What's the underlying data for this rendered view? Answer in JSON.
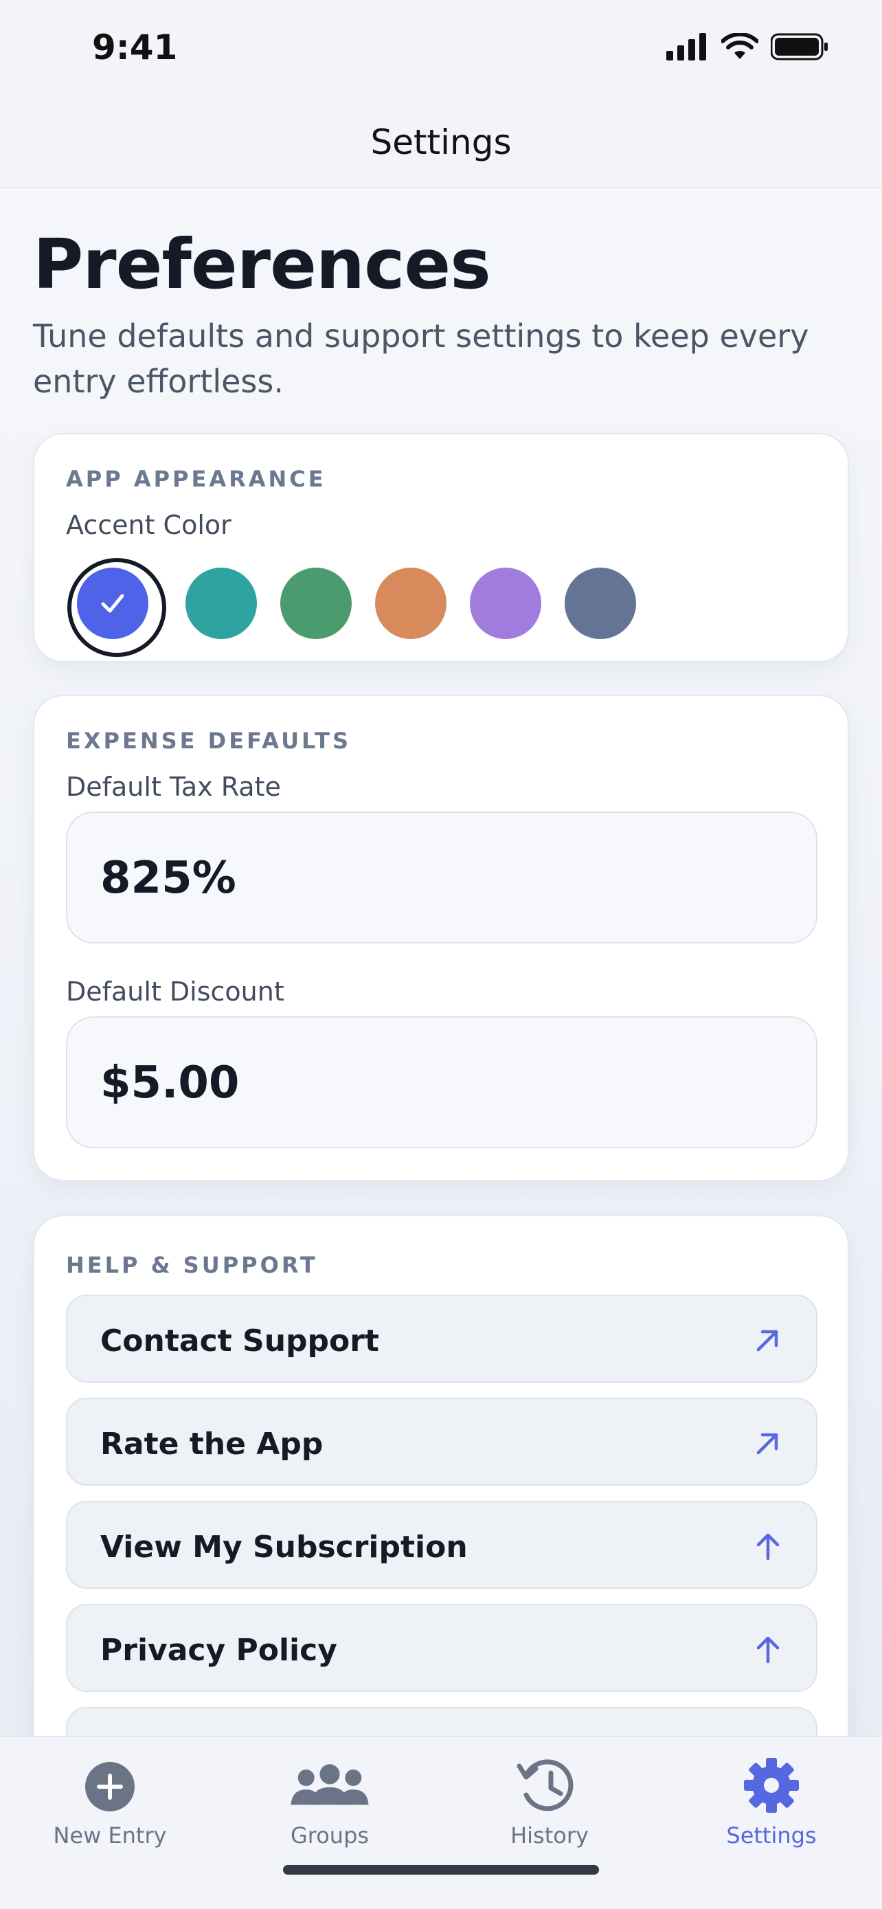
{
  "status_bar": {
    "time": "9:41"
  },
  "nav": {
    "title": "Settings"
  },
  "header": {
    "title": "Preferences",
    "subtitle": "Tune defaults and support settings to keep every entry effortless."
  },
  "appearance": {
    "section_title": "APP APPEARANCE",
    "accent_label": "Accent Color",
    "swatches": [
      {
        "name": "blue",
        "color": "#4f63e8",
        "selected": true
      },
      {
        "name": "teal",
        "color": "#2fa3a0",
        "selected": false
      },
      {
        "name": "green",
        "color": "#4a9c6e",
        "selected": false
      },
      {
        "name": "orange",
        "color": "#d88a5c",
        "selected": false
      },
      {
        "name": "purple",
        "color": "#a07cdc",
        "selected": false
      },
      {
        "name": "slate",
        "color": "#647494",
        "selected": false
      }
    ]
  },
  "expense": {
    "section_title": "EXPENSE DEFAULTS",
    "tax_label": "Default Tax Rate",
    "tax_value": "825%",
    "discount_label": "Default Discount",
    "discount_value": "$5.00"
  },
  "support": {
    "section_title": "HELP & SUPPORT",
    "items": [
      {
        "label": "Contact Support",
        "icon": "arrow-up-right-icon"
      },
      {
        "label": "Rate the App",
        "icon": "arrow-up-right-icon"
      },
      {
        "label": "View My Subscription",
        "icon": "arrow-up-icon"
      },
      {
        "label": "Privacy Policy",
        "icon": "arrow-up-icon"
      }
    ]
  },
  "tabs": [
    {
      "label": "New Entry",
      "icon": "plus-circle-icon",
      "active": false
    },
    {
      "label": "Groups",
      "icon": "people-icon",
      "active": false
    },
    {
      "label": "History",
      "icon": "history-clock-icon",
      "active": false
    },
    {
      "label": "Settings",
      "icon": "gear-icon",
      "active": true
    }
  ],
  "colors": {
    "accent": "#5568e0",
    "text": "#141a26",
    "muted": "#6b7890"
  }
}
